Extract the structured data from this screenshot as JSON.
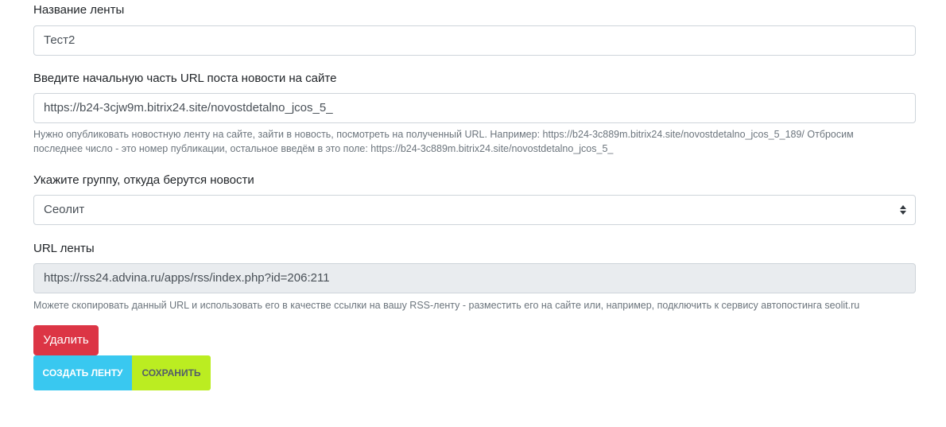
{
  "feed_name": {
    "label": "Название ленты",
    "value": "Тест2"
  },
  "post_url": {
    "label": "Введите начальную часть URL поста новости на сайте",
    "value": "https://b24-3cjw9m.bitrix24.site/novostdetalno_jcos_5_",
    "help_line1": "Нужно опубликовать новостную ленту на сайте, зайти в новость, посмотреть на полученный URL. Например: https://b24-3c889m.bitrix24.site/novostdetalno_jcos_5_189/ Отбросим",
    "help_line2": "последнее число - это номер публикации, остальное введём в это поле: https://b24-3c889m.bitrix24.site/novostdetalno_jcos_5_"
  },
  "group": {
    "label": "Укажите группу, откуда берутся новости",
    "selected": "Сеолит"
  },
  "feed_url": {
    "label": "URL ленты",
    "value": "https://rss24.advina.ru/apps/rss/index.php?id=206:211",
    "help": "Можете скопировать данный URL и использовать его в качестве ссылки на вашу RSS-ленту - разместить его на сайте или, например, подключить к сервису автопостинга seolit.ru"
  },
  "buttons": {
    "delete": "Удалить",
    "create": "СОЗДАТЬ ЛЕНТУ",
    "save": "СОХРАНИТЬ"
  },
  "colors": {
    "danger": "#dc3545",
    "create": "#39c8f0",
    "save": "#bbed21",
    "readonly_bg": "#e9ecef",
    "border": "#ced4da"
  }
}
